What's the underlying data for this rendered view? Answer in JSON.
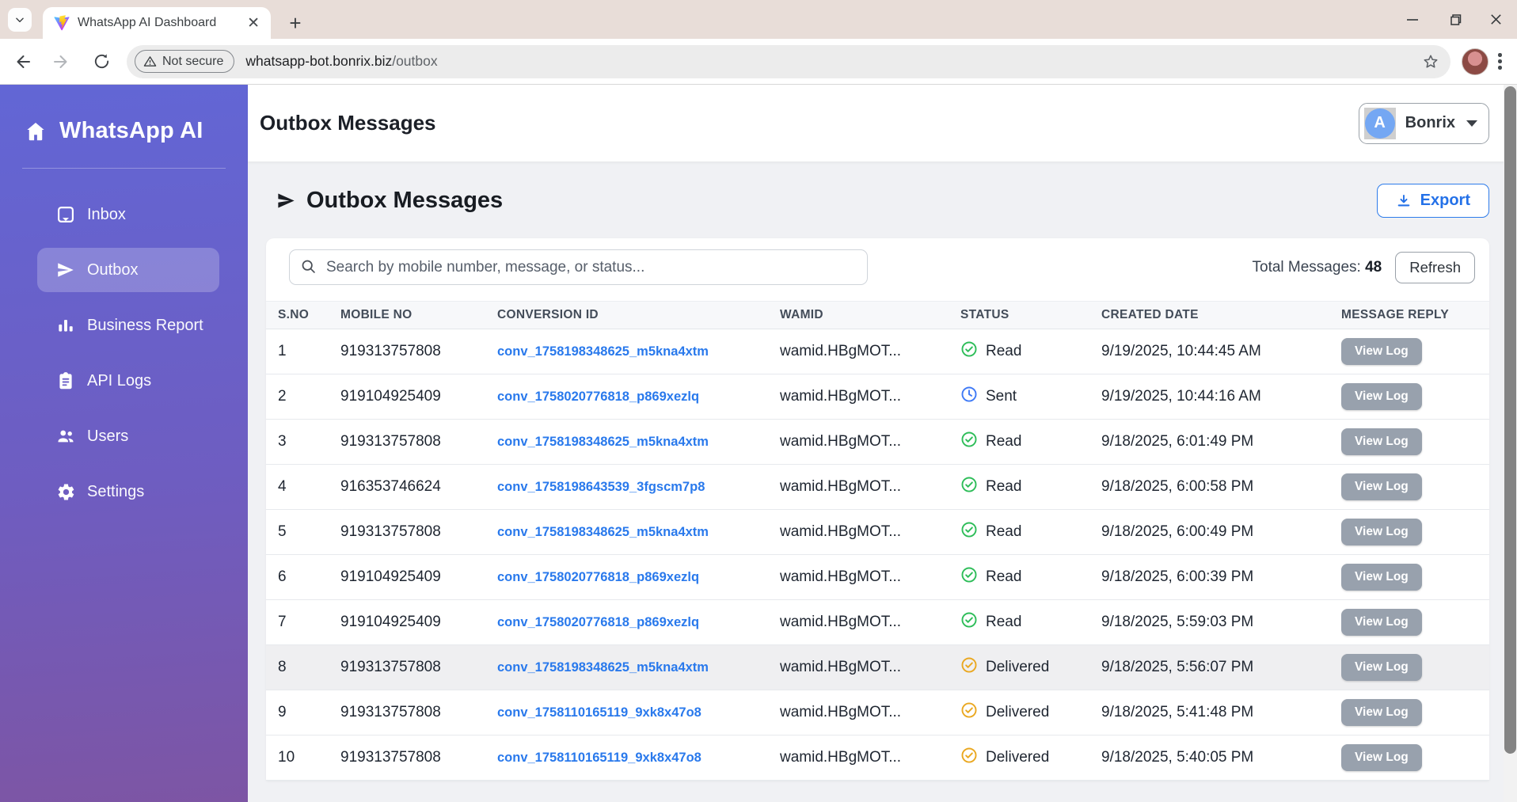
{
  "browser": {
    "tab_title": "WhatsApp AI Dashboard",
    "new_tab": "+",
    "security_label": "Not secure",
    "url_host": "whatsapp-bot.bonrix.biz",
    "url_path": "/outbox"
  },
  "sidebar": {
    "brand": "WhatsApp AI",
    "items": [
      {
        "label": "Inbox",
        "icon": "inbox-icon",
        "active": false
      },
      {
        "label": "Outbox",
        "icon": "send-icon",
        "active": true
      },
      {
        "label": "Business Report",
        "icon": "bar-chart-icon",
        "active": false
      },
      {
        "label": "API Logs",
        "icon": "clipboard-icon",
        "active": false
      },
      {
        "label": "Users",
        "icon": "users-icon",
        "active": false
      },
      {
        "label": "Settings",
        "icon": "gear-icon",
        "active": false
      }
    ]
  },
  "header": {
    "title": "Outbox Messages",
    "user": {
      "initial": "A",
      "name": "Bonrix"
    }
  },
  "main": {
    "section_title": "Outbox Messages",
    "export_label": "Export",
    "search_placeholder": "Search by mobile number, message, or status...",
    "total_label": "Total Messages:",
    "total_value": "48",
    "refresh_label": "Refresh"
  },
  "table": {
    "headers": [
      "S.NO",
      "MOBILE NO",
      "CONVERSION ID",
      "WAMID",
      "STATUS",
      "CREATED DATE",
      "MESSAGE REPLY"
    ],
    "action_label": "View Log",
    "status_colors": {
      "read": "#2ebd59",
      "sent": "#3f7af6",
      "delivered": "#eaa821"
    },
    "rows": [
      {
        "sno": "1",
        "mobile": "919313757808",
        "conversion_id": "conv_1758198348625_m5kna4xtm",
        "wamid": "wamid.HBgMOT...",
        "status": "Read",
        "status_icon": "check-circle-icon",
        "status_color": "#2ebd59",
        "created": "9/19/2025, 10:44:45 AM",
        "highlight": false
      },
      {
        "sno": "2",
        "mobile": "919104925409",
        "conversion_id": "conv_1758020776818_p869xezlq",
        "wamid": "wamid.HBgMOT...",
        "status": "Sent",
        "status_icon": "clock-icon",
        "status_color": "#3f7af6",
        "created": "9/19/2025, 10:44:16 AM",
        "highlight": false
      },
      {
        "sno": "3",
        "mobile": "919313757808",
        "conversion_id": "conv_1758198348625_m5kna4xtm",
        "wamid": "wamid.HBgMOT...",
        "status": "Read",
        "status_icon": "check-circle-icon",
        "status_color": "#2ebd59",
        "created": "9/18/2025, 6:01:49 PM",
        "highlight": false
      },
      {
        "sno": "4",
        "mobile": "916353746624",
        "conversion_id": "conv_1758198643539_3fgscm7p8",
        "wamid": "wamid.HBgMOT...",
        "status": "Read",
        "status_icon": "check-circle-icon",
        "status_color": "#2ebd59",
        "created": "9/18/2025, 6:00:58 PM",
        "highlight": false
      },
      {
        "sno": "5",
        "mobile": "919313757808",
        "conversion_id": "conv_1758198348625_m5kna4xtm",
        "wamid": "wamid.HBgMOT...",
        "status": "Read",
        "status_icon": "check-circle-icon",
        "status_color": "#2ebd59",
        "created": "9/18/2025, 6:00:49 PM",
        "highlight": false
      },
      {
        "sno": "6",
        "mobile": "919104925409",
        "conversion_id": "conv_1758020776818_p869xezlq",
        "wamid": "wamid.HBgMOT...",
        "status": "Read",
        "status_icon": "check-circle-icon",
        "status_color": "#2ebd59",
        "created": "9/18/2025, 6:00:39 PM",
        "highlight": false
      },
      {
        "sno": "7",
        "mobile": "919104925409",
        "conversion_id": "conv_1758020776818_p869xezlq",
        "wamid": "wamid.HBgMOT...",
        "status": "Read",
        "status_icon": "check-circle-icon",
        "status_color": "#2ebd59",
        "created": "9/18/2025, 5:59:03 PM",
        "highlight": false
      },
      {
        "sno": "8",
        "mobile": "919313757808",
        "conversion_id": "conv_1758198348625_m5kna4xtm",
        "wamid": "wamid.HBgMOT...",
        "status": "Delivered",
        "status_icon": "check-circle-icon",
        "status_color": "#eaa821",
        "created": "9/18/2025, 5:56:07 PM",
        "highlight": true
      },
      {
        "sno": "9",
        "mobile": "919313757808",
        "conversion_id": "conv_1758110165119_9xk8x47o8",
        "wamid": "wamid.HBgMOT...",
        "status": "Delivered",
        "status_icon": "check-circle-icon",
        "status_color": "#eaa821",
        "created": "9/18/2025, 5:41:48 PM",
        "highlight": false
      },
      {
        "sno": "10",
        "mobile": "919313757808",
        "conversion_id": "conv_1758110165119_9xk8x47o8",
        "wamid": "wamid.HBgMOT...",
        "status": "Delivered",
        "status_icon": "check-circle-icon",
        "status_color": "#eaa821",
        "created": "9/18/2025, 5:40:05 PM",
        "highlight": false
      }
    ]
  }
}
